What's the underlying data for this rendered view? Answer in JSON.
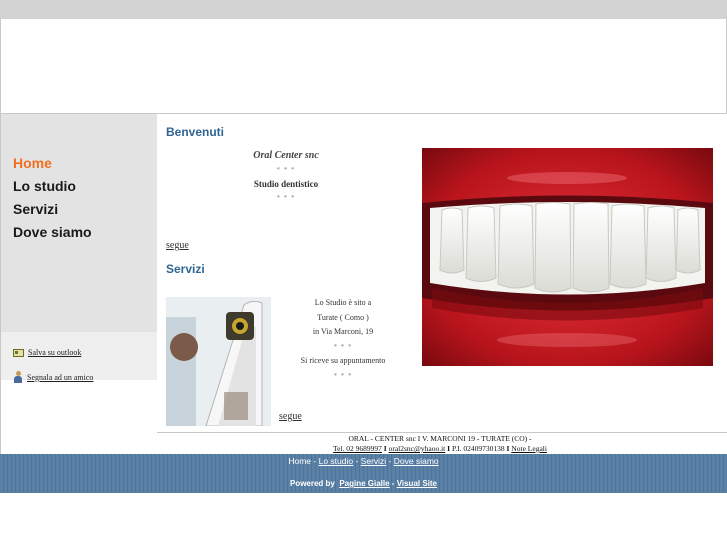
{
  "nav": {
    "items": [
      "Home",
      "Lo studio",
      "Servizi",
      "Dove siamo"
    ],
    "active": "Home"
  },
  "sidebar_links": {
    "outlook": "Salva su outlook",
    "amico": "Segnala ad un amico"
  },
  "welcome": {
    "heading": "Benvenuti",
    "company": "Oral Center snc",
    "stars": "* * *",
    "subtitle": "Studio dentistico",
    "more": "segue"
  },
  "services": {
    "heading": "Servizi",
    "line1": "Lo Studio è sito a",
    "line2": "Turate ( Como )",
    "line3": "in Via Marconi, 19",
    "stars": "* * *",
    "line4": "Si riceve su appuntamento",
    "more": "segue"
  },
  "footer": {
    "address": "ORAL - CENTER snc I V. MARCONI 19 - TURATE (CO) -",
    "tel": "Tel. 02 9689997",
    "email": "oral2snc@yhaoo.it",
    "piva": "P.I. 02409730138",
    "legal": "Note Legali",
    "sep": " I "
  },
  "bottom_nav": {
    "home": "Home",
    "studio": "Lo studio",
    "servizi": "Servizi",
    "dove": "Dove siamo",
    "sep": " - "
  },
  "powered": {
    "label": "Powered by",
    "pagine": "Pagine Gialle",
    "sep": " - ",
    "visual": "Visual Site"
  },
  "colors": {
    "accent_active": "#f26f21",
    "heading_blue": "#2f6593",
    "bottom_bar": "#5b80a6"
  }
}
